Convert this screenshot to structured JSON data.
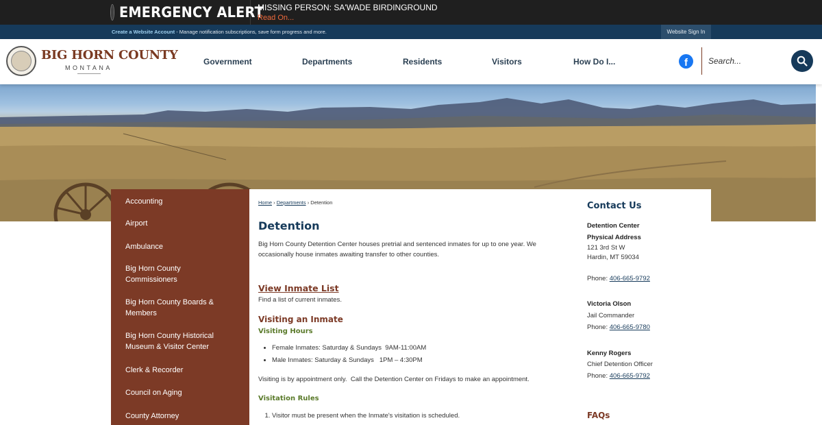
{
  "emergency": {
    "title": "EMERGENCY ALERT",
    "message": "MISSING PERSON: SA'WADE BIRDINGROUND",
    "read_on": "Read On..."
  },
  "account_bar": {
    "create_link": "Create a Website Account",
    "description": " - Manage notification subscriptions, save form progress and more.",
    "sign_in": "Website Sign In"
  },
  "header": {
    "logo_name": "BIG HORN COUNTY",
    "logo_state": "MONTANA",
    "nav": [
      "Government",
      "Departments",
      "Residents",
      "Visitors",
      "How Do I..."
    ],
    "search_placeholder": "Search..."
  },
  "sidebar": {
    "items": [
      "Accounting",
      "Airport",
      "Ambulance",
      "Big Horn County Commissioners",
      "Big Horn County Boards & Members",
      "Big Horn County Historical Museum & Visitor Center",
      "Clerk & Recorder",
      "Council on Aging",
      "County Attorney"
    ]
  },
  "breadcrumb": {
    "home": "Home",
    "sep1": " › ",
    "departments": "Departments",
    "sep2": " › ",
    "current": "Detention"
  },
  "main": {
    "title": "Detention",
    "intro": "Big Horn County Detention Center houses pretrial and sentenced inmates for up to one year. We occasionally house inmates awaiting transfer to other counties.",
    "inmate_link": "View Inmate List",
    "inmate_desc": "Find a list of current inmates.",
    "visiting_heading": "Visiting an Inmate",
    "hours_heading": "Visiting Hours",
    "hours": [
      "Female Inmates: Saturday & Sundays  9AM-11:00AM",
      "Male Inmates: Saturday & Sundays   1PM – 4:30PM"
    ],
    "appointment_note": "Visiting is by appointment only.  Call the Detention Center on Fridays to make an appointment.",
    "rules_heading": "Visitation Rules",
    "rules": [
      "Visitor must be present when the Inmate's visitation is scheduled."
    ]
  },
  "contact": {
    "title": "Contact Us",
    "center_name": "Detention Center",
    "address_label": "Physical Address",
    "address_line1": "121 3rd St W",
    "address_line2": "Hardin, MT 59034",
    "phone_label": "Phone: ",
    "center_phone": "406-665-9792",
    "person1_name": "Victoria Olson",
    "person1_title": "Jail Commander",
    "person1_phone": "406-665-9780",
    "person2_name": "Kenny Rogers",
    "person2_title": "Chief Detention Officer",
    "person2_phone": "406-665-9792",
    "faqs": "FAQs"
  },
  "colors": {
    "brand_navy": "#163a5a",
    "brand_brown": "#7c3a26",
    "alert_red": "#d81e05",
    "subhead_green": "#5a7a2a"
  }
}
